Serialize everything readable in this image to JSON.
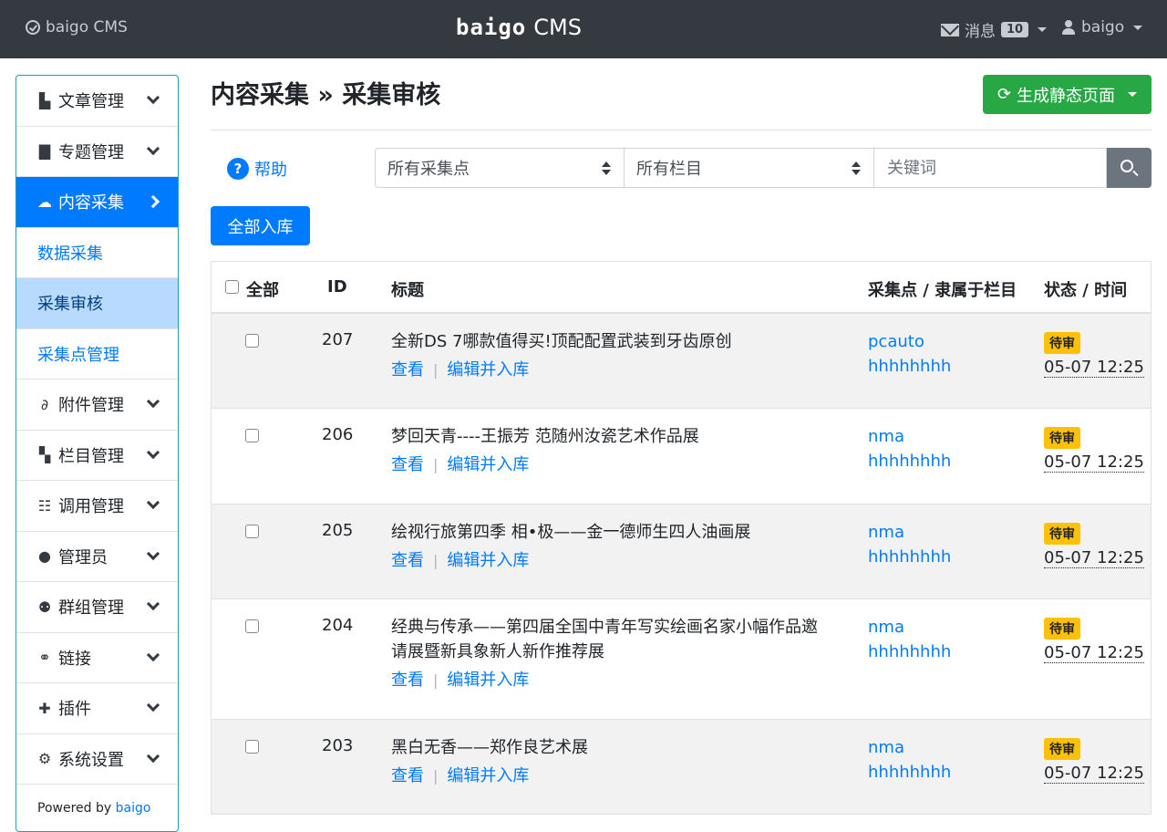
{
  "topbar": {
    "brand_left": "baigo CMS",
    "brand_logo": "baigo",
    "brand_suffix": "CMS",
    "messages_label": "消息",
    "messages_count": "10",
    "user_name": "baigo"
  },
  "sidebar": {
    "items": [
      {
        "label": "文章管理",
        "icon": "file-icon"
      },
      {
        "label": "专题管理",
        "icon": "clipboard-icon"
      },
      {
        "label": "内容采集",
        "icon": "cloud-upload-icon"
      },
      {
        "label": "附件管理",
        "icon": "paperclip-icon"
      },
      {
        "label": "栏目管理",
        "icon": "stack-icon"
      },
      {
        "label": "调用管理",
        "icon": "list-icon"
      },
      {
        "label": "管理员",
        "icon": "user-icon"
      },
      {
        "label": "群组管理",
        "icon": "users-icon"
      },
      {
        "label": "链接",
        "icon": "link-icon"
      },
      {
        "label": "插件",
        "icon": "puzzle-icon"
      },
      {
        "label": "系统设置",
        "icon": "gear-icon"
      }
    ],
    "sub_items": [
      "数据采集",
      "采集审核",
      "采集点管理"
    ],
    "powered_prefix": "Powered by",
    "powered_link": "baigo"
  },
  "page": {
    "title": "内容采集 » 采集审核",
    "generate_button": "生成静态页面",
    "help_label": "帮助",
    "filter_source": "所有采集点",
    "filter_column": "所有栏目",
    "keyword_placeholder": "关键词",
    "import_all_button": "全部入库"
  },
  "table": {
    "headers": {
      "all": "全部",
      "id": "ID",
      "title": "标题",
      "source": "采集点 / 隶属于栏目",
      "status": "状态 / 时间"
    },
    "action_view": "查看",
    "action_sep": "|",
    "action_edit": "编辑并入库",
    "rows": [
      {
        "id": "207",
        "title": "全新DS 7哪款值得买!顶配配置武装到牙齿原创",
        "source": "pcauto",
        "column": "hhhhhhhh",
        "status": "待审",
        "time": "05-07 12:25"
      },
      {
        "id": "206",
        "title": "梦回天青----王振芳 范随州汝瓷艺术作品展",
        "source": "nma",
        "column": "hhhhhhhh",
        "status": "待审",
        "time": "05-07 12:25"
      },
      {
        "id": "205",
        "title": "绘视行旅第四季 相•极——金一德师生四人油画展",
        "source": "nma",
        "column": "hhhhhhhh",
        "status": "待审",
        "time": "05-07 12:25"
      },
      {
        "id": "204",
        "title_line1": "经典与传承——第四届全国中青年写实绘画名家小幅作品邀",
        "title_line2": "请展暨新具象新人新作推荐展",
        "source": "nma",
        "column": "hhhhhhhh",
        "status": "待审",
        "time": "05-07 12:25"
      },
      {
        "id": "203",
        "title": "黑白无香——郑作良艺术展",
        "source": "nma",
        "column": "hhhhhhhh",
        "status": "待审",
        "time": "05-07 12:25"
      }
    ]
  }
}
